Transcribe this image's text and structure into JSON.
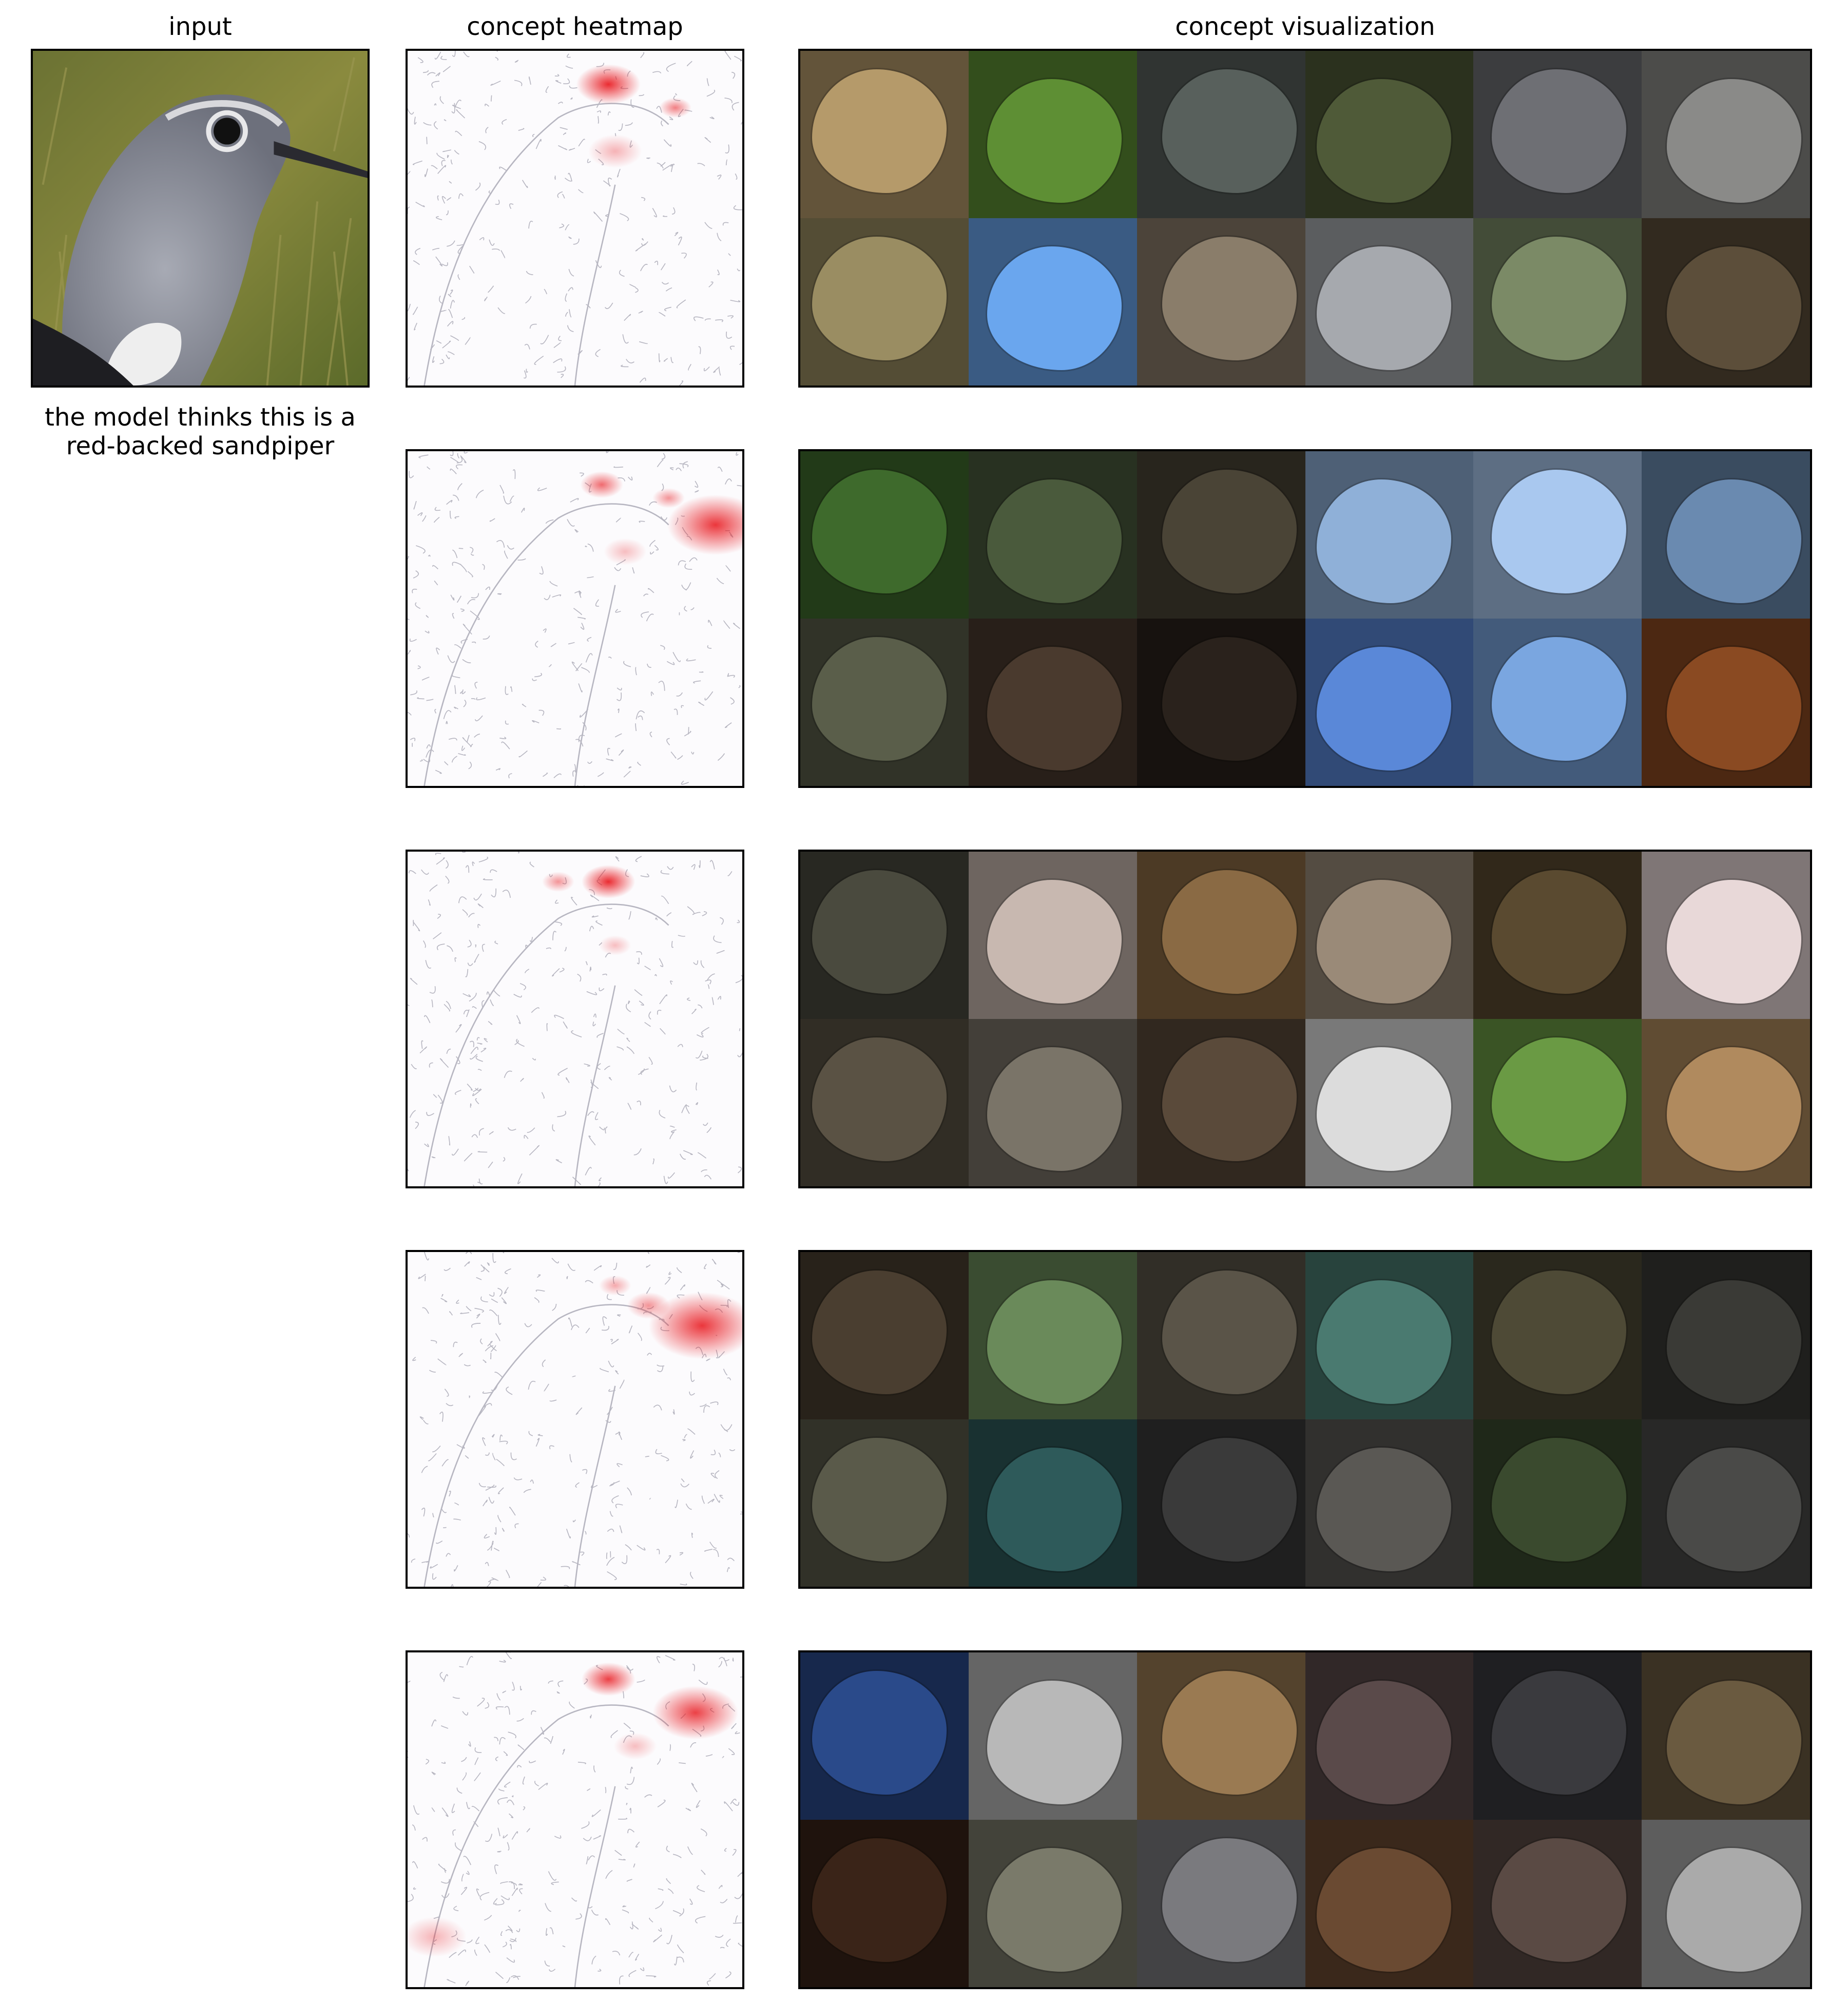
{
  "headers": {
    "input": "input",
    "heatmap": "concept heatmap",
    "visualization": "concept visualization"
  },
  "caption": {
    "line1": "the model thinks this is a",
    "line2": "red-backed sandpiper"
  },
  "colors": {
    "heat": "#e8151b",
    "outline": "#9a9aa8",
    "frame": "#000000"
  },
  "concepts": [
    {
      "tiles": [
        "#b59a6a",
        "#5e8f34",
        "#58605c",
        "#4f5a38",
        "#6e6f74",
        "#8a8a88",
        "#9a8d62",
        "#6aa6ee",
        "#8a7d6a",
        "#a6a9ae",
        "#7b8a66",
        "#5c4e3a"
      ]
    },
    {
      "tiles": [
        "#3e6a2c",
        "#4a5a3c",
        "#4a4436",
        "#8fb0d8",
        "#a9c8ef",
        "#6a8ab0",
        "#5a5e4a",
        "#4a3a2e",
        "#2a221c",
        "#5a88d8",
        "#7aa6e0",
        "#8a4a22"
      ]
    },
    {
      "tiles": [
        "#4a4a3e",
        "#c8b8b0",
        "#8a6a44",
        "#9a8a78",
        "#5a4a30",
        "#e8d8d8",
        "#5a5244",
        "#7a7468",
        "#5a4a3a",
        "#dcdcdc",
        "#6a9a44",
        "#b08a5e"
      ]
    },
    {
      "tiles": [
        "#4a3e30",
        "#6a8a5a",
        "#5a5448",
        "#4a7a70",
        "#4e4a36",
        "#3a3a36",
        "#5a5a4a",
        "#2e5a5a",
        "#3a3a3a",
        "#5a5854",
        "#3a4a2e",
        "#4a4a48"
      ]
    },
    {
      "tiles": [
        "#2a4a8a",
        "#b8b8b8",
        "#9a7a52",
        "#5a4a4a",
        "#3a3a3e",
        "#6a5a40",
        "#3a2418",
        "#7a7a6a",
        "#7a7a7e",
        "#6a4a32",
        "#5a4a44",
        "#aaaaaa"
      ]
    }
  ]
}
